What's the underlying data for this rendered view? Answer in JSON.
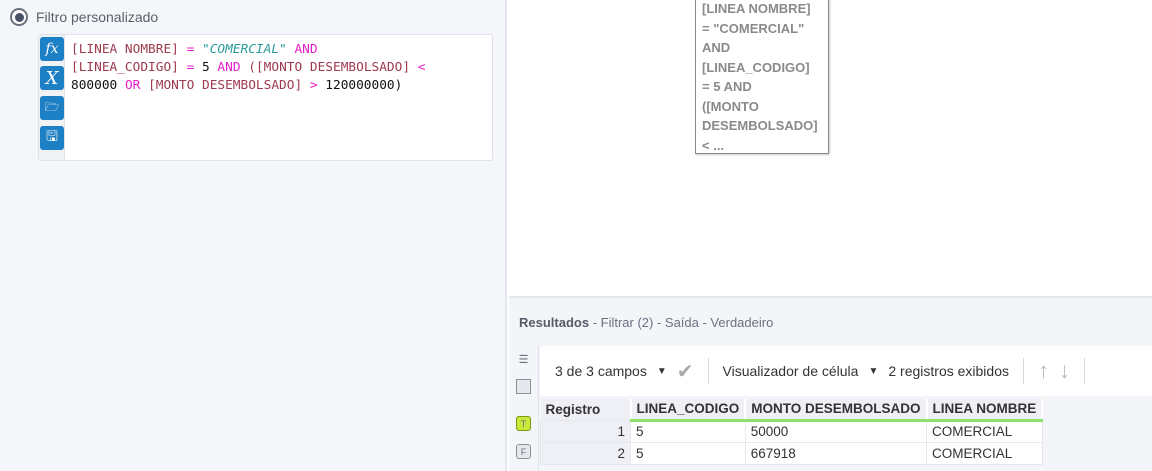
{
  "filter": {
    "option_label": "Filtro personalizado",
    "code": [
      [
        {
          "t": "[LINEA NOMBRE]",
          "c": "f"
        },
        {
          "t": " = ",
          "c": "k"
        },
        {
          "t": "\"COMERCIAL\"",
          "c": "s"
        },
        {
          "t": " AND",
          "c": "k"
        }
      ],
      [
        {
          "t": "[LINEA_CODIGO]",
          "c": "f"
        },
        {
          "t": " = ",
          "c": "k"
        },
        {
          "t": "5",
          "c": "n"
        },
        {
          "t": " AND ",
          "c": "k"
        },
        {
          "t": "([MONTO DESEMBOLSADO]",
          "c": "p"
        },
        {
          "t": " <",
          "c": "k"
        }
      ],
      [
        {
          "t": "800000",
          "c": "n"
        },
        {
          "t": " OR ",
          "c": "k"
        },
        {
          "t": "[MONTO DESEMBOLSADO]",
          "c": "f"
        },
        {
          "t": " > ",
          "c": "k"
        },
        {
          "t": "120000000",
          "c": "n"
        },
        {
          "t": ")",
          "c": "n"
        }
      ]
    ]
  },
  "annotation": {
    "lines": [
      "[LINEA NOMBRE]",
      "= \"COMERCIAL\"",
      "AND",
      "[LINEA_CODIGO]",
      "= 5 AND",
      "([MONTO",
      "DESEMBOLSADO]",
      "< ..."
    ]
  },
  "results": {
    "title": "Resultados",
    "subtitle": " - Filtrar (2) - Saída - Verdadeiro",
    "fields": "3 de 3 campos",
    "viewer": "Visualizador de célula",
    "records": "2 registros exibidos",
    "columns": [
      "Registro",
      "LINEA_CODIGO",
      "MONTO DESEMBOLSADO",
      "LINEA NOMBRE"
    ],
    "rows": [
      [
        "1",
        "5",
        "50000",
        "COMERCIAL"
      ],
      [
        "2",
        "5",
        "667918",
        "COMERCIAL"
      ]
    ]
  }
}
